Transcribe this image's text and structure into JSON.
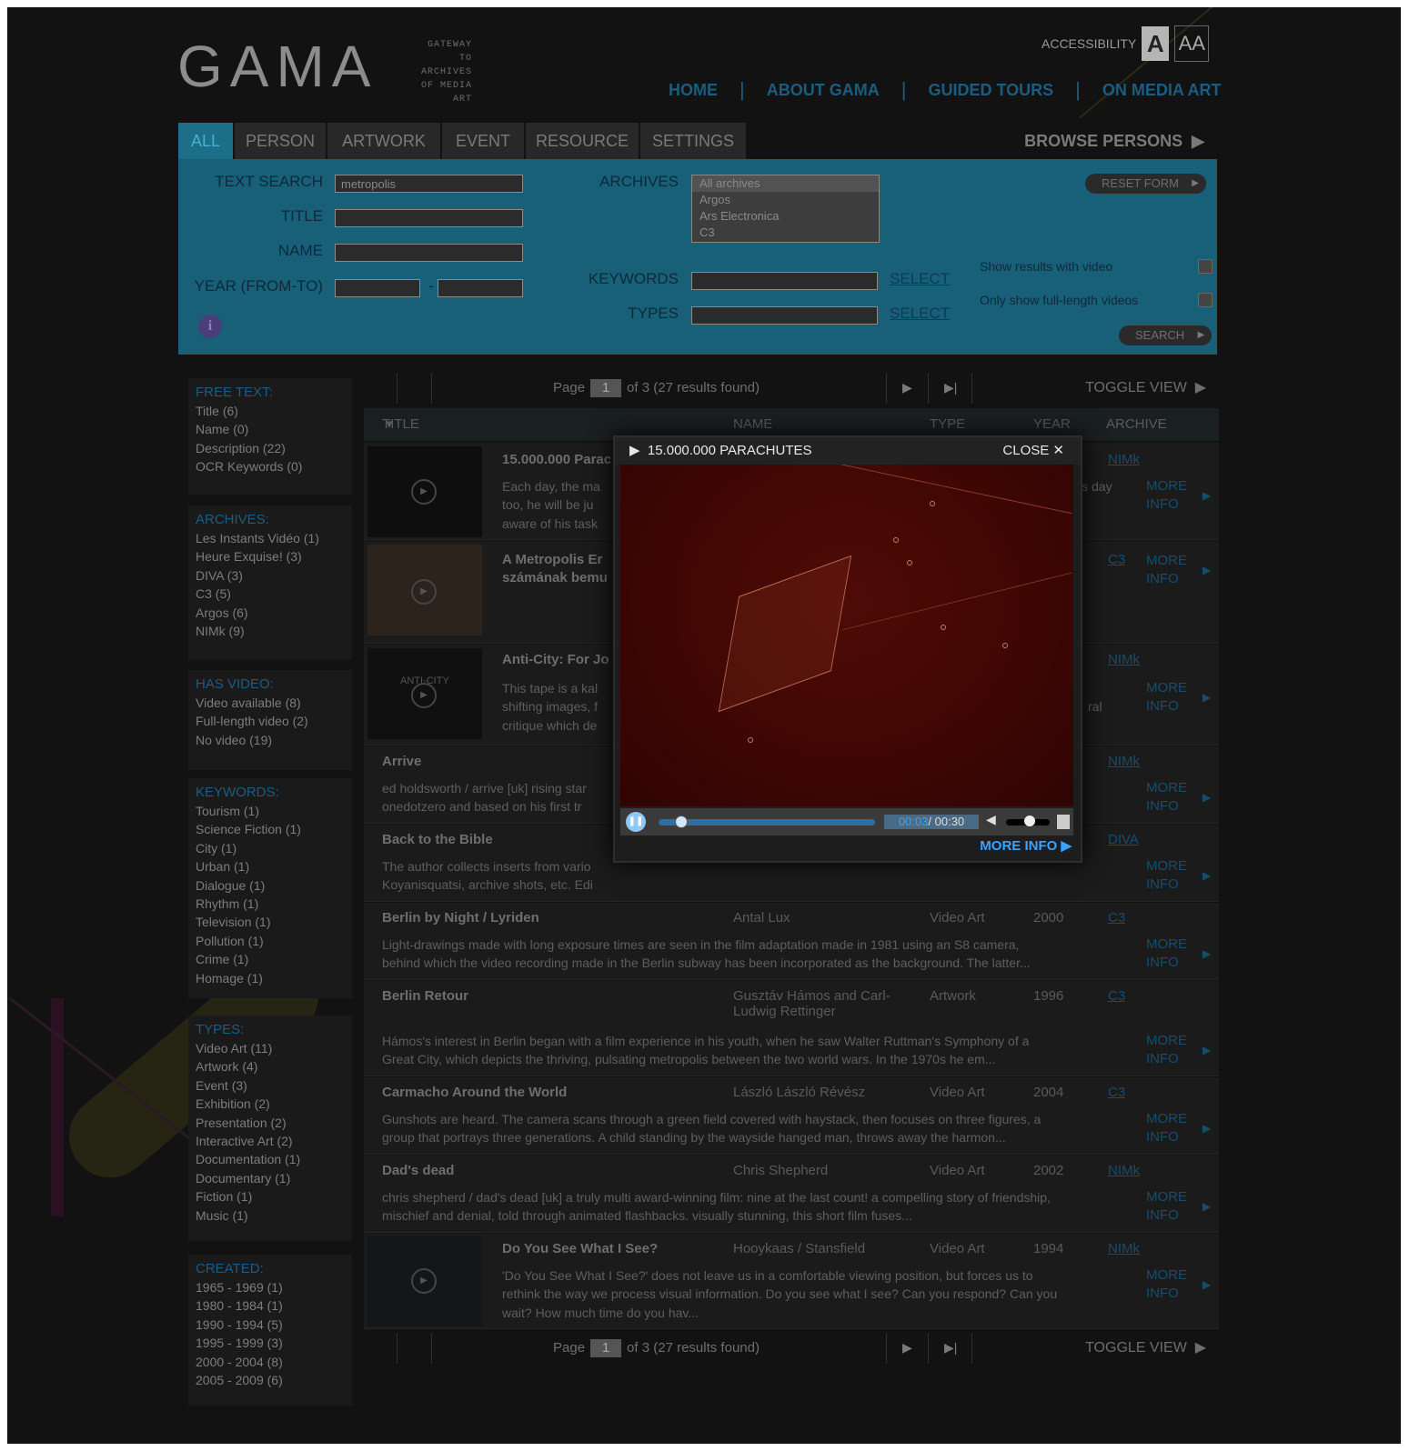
{
  "logo": {
    "text": "GAMA",
    "subtitle_lines": [
      "GATEWAY",
      "TO ARCHIVES",
      "OF MEDIA",
      "ART"
    ]
  },
  "accessibility": {
    "label": "ACCESSIBILITY",
    "contrast_icon": "contrast-icon",
    "font_size_label": "AA"
  },
  "topnav": [
    "HOME",
    "ABOUT GAMA",
    "GUIDED TOURS",
    "ON MEDIA ART"
  ],
  "tabs": [
    "ALL",
    "PERSON",
    "ARTWORK",
    "EVENT",
    "RESOURCE",
    "SETTINGS"
  ],
  "browse": "BROWSE PERSONS",
  "search": {
    "text_search_label": "TEXT SEARCH",
    "text_search_value": "metropolis",
    "title_label": "TITLE",
    "name_label": "NAME",
    "year_label": "YEAR (FROM-TO)",
    "year_sep": "-",
    "archives_label": "ARCHIVES",
    "archives_options": [
      "All archives",
      "Argos",
      "Ars Electronica",
      "C3"
    ],
    "keywords_label": "KEYWORDS",
    "types_label": "TYPES",
    "select_link": "SELECT",
    "reset": "RESET FORM",
    "show_video": "Show results with video",
    "full_length": "Only show full-length videos",
    "search_btn": "SEARCH",
    "info_icon": "i"
  },
  "facets": {
    "free_text": {
      "title": "FREE TEXT:",
      "items": [
        "Title (6)",
        "Name (0)",
        "Description (22)",
        "OCR Keywords (0)"
      ]
    },
    "archives": {
      "title": "ARCHIVES:",
      "items": [
        "Les Instants Vidéo (1)",
        "Heure Exquise! (3)",
        "DIVA (3)",
        "C3 (5)",
        "Argos (6)",
        "NIMk (9)"
      ]
    },
    "has_video": {
      "title": "HAS VIDEO:",
      "items": [
        "Video available (8)",
        "Full-length video (2)",
        "No video (19)"
      ]
    },
    "keywords": {
      "title": "KEYWORDS:",
      "items": [
        "Tourism (1)",
        "Science Fiction (1)",
        "City (1)",
        "Urban (1)",
        "Dialogue (1)",
        "Rhythm (1)",
        "Television (1)",
        "Pollution (1)",
        "Crime (1)",
        "Homage (1)"
      ]
    },
    "types": {
      "title": "TYPES:",
      "items": [
        "Video Art (11)",
        "Artwork (4)",
        "Event (3)",
        "Exhibition (2)",
        "Presentation (2)",
        "Interactive Art (2)",
        "Documentation (1)",
        "Documentary (1)",
        "Fiction (1)",
        "Music (1)"
      ]
    },
    "created": {
      "title": "CREATED:",
      "items": [
        "1965 - 1969 (1)",
        "1980 - 1984 (1)",
        "1990 - 1994 (5)",
        "1995 - 1999 (3)",
        "2000 - 2004 (8)",
        "2005 - 2009 (6)"
      ]
    }
  },
  "pager": {
    "page_label": "Page",
    "page_num": "1",
    "of_text": "of 3 (27 results found)",
    "toggle": "TOGGLE VIEW"
  },
  "table_headers": {
    "title": "TITLE",
    "name": "NAME",
    "type": "TYPE",
    "year": "YEAR",
    "archive": "ARCHIVE"
  },
  "more_info": [
    "MORE",
    "INFO"
  ],
  "rows": [
    {
      "title": "15.000.000 Parac",
      "desc": [
        "Each day, the ma",
        "too, he will be ju",
        "aware of his task"
      ],
      "desc_tail": "is day",
      "archive": "NIMk"
    },
    {
      "title": "A Metropolis Er",
      "title2": "számának bemu",
      "archive": "C3"
    },
    {
      "title": "Anti-City: For Jo",
      "desc": [
        "This tape is a kal",
        "shifting images, f",
        "critique which de"
      ],
      "desc_tail": "ral",
      "archive": "NIMk",
      "thumb_text": "ANTI-CITY"
    },
    {
      "title": "Arrive",
      "desc": [
        "ed holdsworth / arrive [uk] rising star",
        "onedotzero and based on his first tr"
      ],
      "archive": "NIMk"
    },
    {
      "title": "Back to the Bible",
      "desc": [
        "The author collects inserts from vario",
        "Koyanisquatsi, archive shots, etc. Edi"
      ],
      "archive": "DIVA"
    },
    {
      "title": "Berlin by Night / Lyriden",
      "name": "Antal Lux",
      "type": "Video Art",
      "year": "2000",
      "archive": "C3",
      "desc": [
        "Light-drawings made with long exposure times are seen in the film adaptation made in 1981 using an S8 camera,",
        "behind which the video recording made in the Berlin subway has been incorporated as the background. The latter..."
      ]
    },
    {
      "title": "Berlin Retour",
      "name": "Gusztáv Hámos and Carl-",
      "name2": "Ludwig Rettinger",
      "type": "Artwork",
      "year": "1996",
      "archive": "C3",
      "desc": [
        "Hámos's interest in Berlin began with a film experience in his youth, when he saw Walter Ruttman's Symphony of a",
        "Great City, which depicts the thriving, pulsating metropolis between the two world wars. In the 1970s he em..."
      ]
    },
    {
      "title": "Carmacho Around the World",
      "name": "László László Révész",
      "type": "Video Art",
      "year": "2004",
      "archive": "C3",
      "desc": [
        "Gunshots are heard. The camera scans through a green field covered with haystack, then focuses on three figures, a",
        "group that portrays three generations. A child standing by the wayside hanged man, throws away the harmon..."
      ]
    },
    {
      "title": "Dad's dead",
      "name": "Chris Shepherd",
      "type": "Video Art",
      "year": "2002",
      "archive": "NIMk",
      "desc": [
        "chris shepherd / dad's dead [uk] a truly multi award-winning film: nine at the last count! a compelling story of friendship,",
        "mischief and denial, told through animated flashbacks. visually stunning, this short film fuses..."
      ]
    },
    {
      "title": "Do You See What I See?",
      "name": "Hooykaas / Stansfield",
      "type": "Video Art",
      "year": "1994",
      "archive": "NIMk",
      "desc": [
        "'Do You See What I See?' does not leave us in a comfortable viewing position, but forces us to",
        "rethink the way we process visual information. Do you see what I see? Can you respond? Can you",
        "wait? How much time do you hav..."
      ]
    }
  ],
  "modal": {
    "title": "15.000.000 PARACHUTES",
    "close": "CLOSE",
    "time_current": "00:03",
    "time_sep": "/",
    "time_total": "00:30",
    "more_info": "MORE INFO",
    "progress": 0.1
  },
  "colors": {
    "accent": "#185f78",
    "link": "#174d6c",
    "video_bg": "#3f0704",
    "modal_link": "#3aa3ff"
  }
}
